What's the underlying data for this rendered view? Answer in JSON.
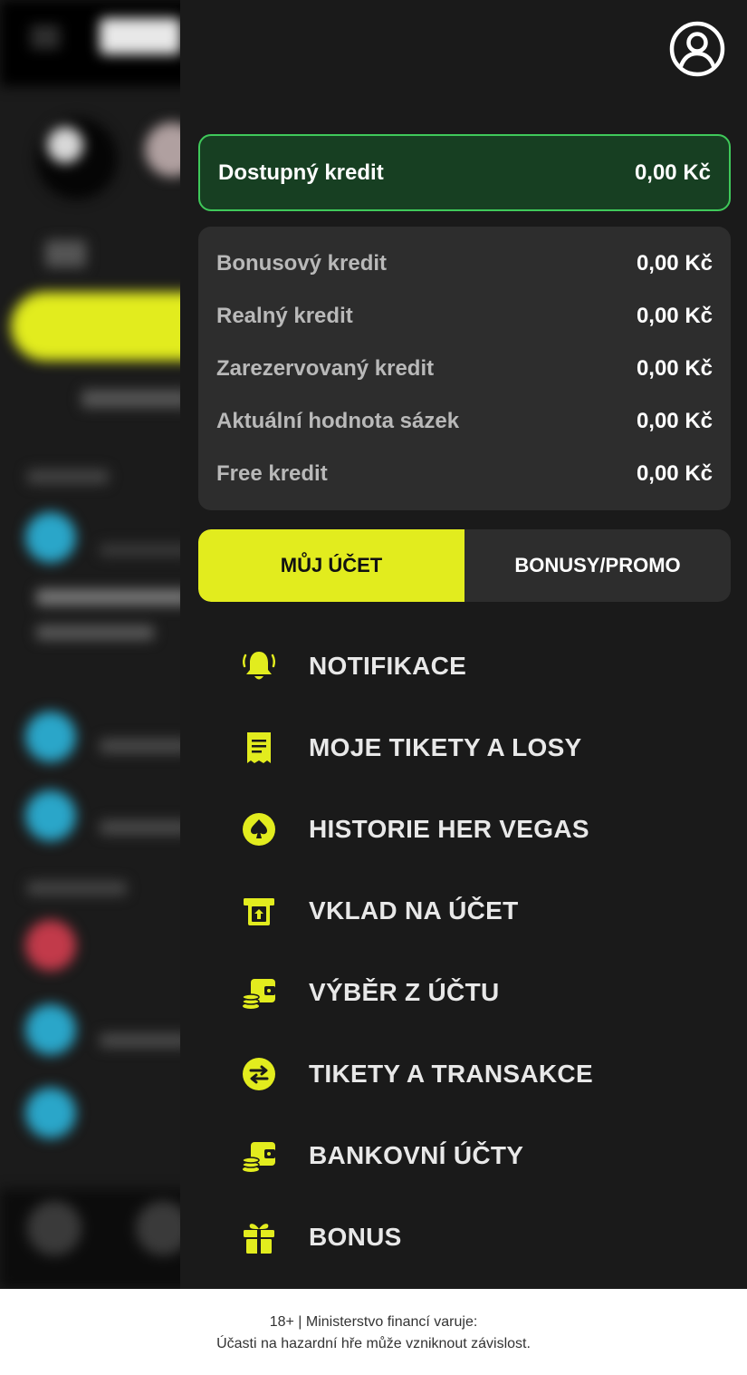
{
  "drawer": {
    "available_credit": {
      "label": "Dostupný kredit",
      "value": "0,00 Kč"
    },
    "credits": [
      {
        "label": "Bonusový kredit",
        "value": "0,00 Kč"
      },
      {
        "label": "Realný kredit",
        "value": "0,00 Kč"
      },
      {
        "label": "Zarezervovaný kredit",
        "value": "0,00 Kč"
      },
      {
        "label": "Aktuální hodnota sázek",
        "value": "0,00 Kč"
      },
      {
        "label": "Free kredit",
        "value": "0,00 Kč"
      }
    ],
    "tabs": [
      {
        "label": "MŮJ ÚČET",
        "active": true
      },
      {
        "label": "BONUSY/PROMO",
        "active": false
      }
    ],
    "menu": [
      {
        "label": "NOTIFIKACE",
        "icon": "bell-icon"
      },
      {
        "label": "MOJE TIKETY A LOSY",
        "icon": "receipt-icon"
      },
      {
        "label": "HISTORIE HER VEGAS",
        "icon": "spade-icon"
      },
      {
        "label": "VKLAD NA ÚČET",
        "icon": "deposit-icon"
      },
      {
        "label": "VÝBĚR Z ÚČTU",
        "icon": "wallet-coins-icon"
      },
      {
        "label": "TIKETY A TRANSAKCE",
        "icon": "transfer-arrows-icon"
      },
      {
        "label": "BANKOVNÍ ÚČTY",
        "icon": "wallet-coins-icon"
      },
      {
        "label": "BONUS",
        "icon": "gift-icon"
      }
    ],
    "accent_color": "#e2ec1e",
    "credit_border_color": "#3fc95a"
  },
  "footer": {
    "line1": "18+ | Ministerstvo financí varuje:",
    "line2": "Účasti na hazardní hře může vzniknout závislost."
  }
}
